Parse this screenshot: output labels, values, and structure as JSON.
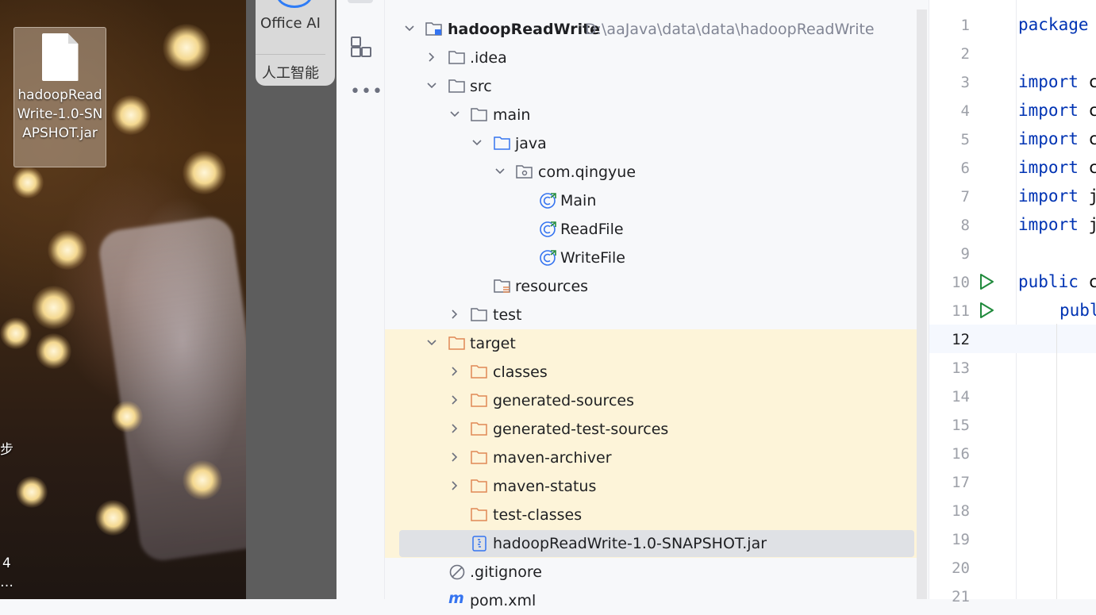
{
  "desktop": {
    "icon_label": "hadoopReadWrite-1.0-SNAPSHOT.jar",
    "edge_text_1": "步",
    "edge_text_2": "4",
    "edge_text_3": "…"
  },
  "office_widget": {
    "title": "Office AI",
    "subtitle": "人工智能"
  },
  "project": {
    "root_name": "hadoopReadWrite",
    "root_path": "D:\\aaJava\\data\\data\\hadoopReadWrite",
    "items": [
      {
        "label": ".idea",
        "icon": "folder-icon"
      },
      {
        "label": "src",
        "icon": "folder-icon"
      },
      {
        "label": "main",
        "icon": "folder-icon"
      },
      {
        "label": "java",
        "icon": "source-folder-icon"
      },
      {
        "label": "com.qingyue",
        "icon": "package-icon"
      },
      {
        "label": "Main",
        "icon": "java-class-icon"
      },
      {
        "label": "ReadFile",
        "icon": "java-class-icon"
      },
      {
        "label": "WriteFile",
        "icon": "java-class-icon"
      },
      {
        "label": "resources",
        "icon": "resources-folder-icon"
      },
      {
        "label": "test",
        "icon": "folder-icon"
      },
      {
        "label": "target",
        "icon": "excluded-folder-icon"
      },
      {
        "label": "classes",
        "icon": "excluded-folder-icon"
      },
      {
        "label": "generated-sources",
        "icon": "excluded-folder-icon"
      },
      {
        "label": "generated-test-sources",
        "icon": "excluded-folder-icon"
      },
      {
        "label": "maven-archiver",
        "icon": "excluded-folder-icon"
      },
      {
        "label": "maven-status",
        "icon": "excluded-folder-icon"
      },
      {
        "label": "test-classes",
        "icon": "excluded-folder-icon"
      },
      {
        "label": "hadoopReadWrite-1.0-SNAPSHOT.jar",
        "icon": "jar-icon"
      },
      {
        "label": ".gitignore",
        "icon": "ignore-icon"
      },
      {
        "label": "pom.xml",
        "icon": "maven-icon"
      }
    ]
  },
  "editor": {
    "line_numbers": [
      "1",
      "2",
      "3",
      "4",
      "5",
      "6",
      "7",
      "8",
      "9",
      "10",
      "11",
      "12",
      "13",
      "14",
      "15",
      "16",
      "17",
      "18",
      "19",
      "20",
      "21"
    ],
    "code": {
      "l1_kw": "package",
      "l1_rest": "",
      "l3_kw": "import",
      "l3_rest": "c",
      "l4_kw": "import",
      "l4_rest": "c",
      "l5_kw": "import",
      "l5_rest": "c",
      "l6_kw": "import",
      "l6_rest": "c",
      "l7_kw": "import",
      "l7_rest": "j",
      "l8_kw": "import",
      "l8_rest": "j",
      "l10_kw": "public",
      "l10_rest": "c",
      "l11_kw": "publ",
      "l11_rest": ""
    },
    "current_line": "12"
  },
  "colors": {
    "keyword": "#0033b3",
    "excluded_highlight": "#fdf4d9",
    "run_green": "#208a3c",
    "folder_orange": "#e08855"
  }
}
